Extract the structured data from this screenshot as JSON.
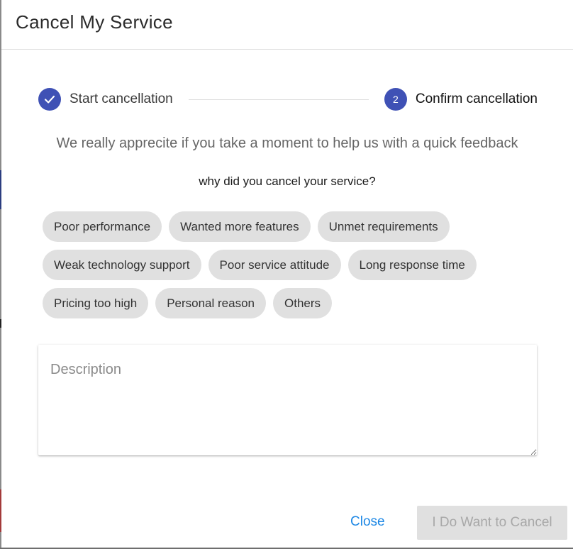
{
  "dialog": {
    "title": "Cancel My Service"
  },
  "stepper": {
    "steps": [
      {
        "label": "Start cancellation",
        "state": "completed",
        "icon": "check-icon"
      },
      {
        "label": "Confirm cancellation",
        "state": "active",
        "number": "2"
      }
    ]
  },
  "feedback": {
    "intro": "We really apprecite if you take a moment to help us with a quick feedback",
    "question": "why did you cancel your service?"
  },
  "reasons": [
    "Poor performance",
    "Wanted more features",
    "Unmet requirements",
    "Weak technology support",
    "Poor service attitude",
    "Long response time",
    "Pricing too high",
    "Personal reason",
    "Others"
  ],
  "description": {
    "placeholder": "Description",
    "value": ""
  },
  "actions": {
    "close_label": "Close",
    "confirm_label": "I Do Want to Cancel",
    "confirm_disabled": true
  },
  "colors": {
    "accent": "#3f51b5",
    "link": "#1e88e5",
    "chip_bg": "#e0e0e0",
    "disabled_bg": "#e0e0e0",
    "disabled_text": "#a8a8a8"
  }
}
